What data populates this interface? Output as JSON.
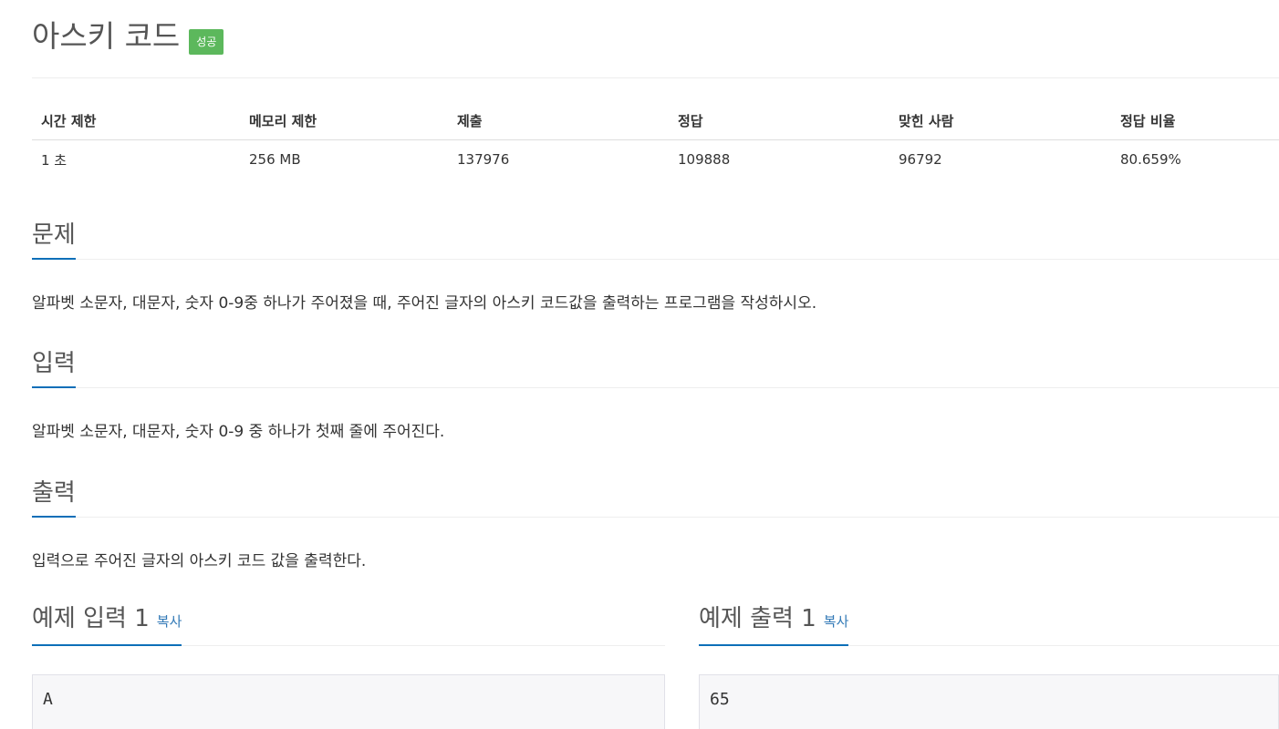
{
  "problem": {
    "title": "아스키 코드",
    "status_badge": "성공"
  },
  "info_table": {
    "headers": [
      "시간 제한",
      "메모리 제한",
      "제출",
      "정답",
      "맞힌 사람",
      "정답 비율"
    ],
    "values": [
      "1 초",
      "256 MB",
      "137976",
      "109888",
      "96792",
      "80.659%"
    ]
  },
  "sections": {
    "problem": {
      "heading": "문제",
      "body": "알파벳 소문자, 대문자, 숫자 0-9중 하나가 주어졌을 때, 주어진 글자의 아스키 코드값을 출력하는 프로그램을 작성하시오."
    },
    "input": {
      "heading": "입력",
      "body": "알파벳 소문자, 대문자, 숫자 0-9 중 하나가 첫째 줄에 주어진다."
    },
    "output": {
      "heading": "출력",
      "body": "입력으로 주어진 글자의 아스키 코드 값을 출력한다."
    }
  },
  "samples": {
    "input": {
      "heading": "예제 입력 1",
      "copy_label": "복사",
      "content": "A"
    },
    "output": {
      "heading": "예제 출력 1",
      "copy_label": "복사",
      "content": "65"
    }
  },
  "colors": {
    "badge": "#5cb85c",
    "section_underline": "#0d6fb8",
    "link": "#337ab7"
  }
}
